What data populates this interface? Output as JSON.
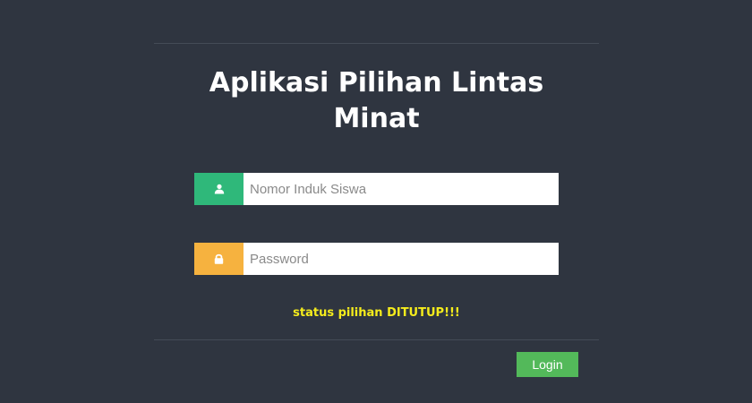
{
  "app": {
    "title": "Aplikasi Pilihan Lintas Minat"
  },
  "form": {
    "username": {
      "icon": "user-icon",
      "placeholder": "Nomor Induk Siswa",
      "value": ""
    },
    "password": {
      "icon": "lock-icon",
      "placeholder": "Password",
      "value": ""
    },
    "status_message": "status pilihan DITUTUP!!!",
    "login_label": "Login"
  },
  "colors": {
    "background": "#2f3540",
    "username_addon": "#2fb87a",
    "password_addon": "#f6b23f",
    "status_text": "#f5ec1c",
    "login_button": "#53b95a"
  }
}
